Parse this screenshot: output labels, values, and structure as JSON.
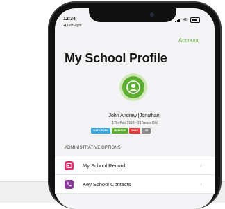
{
  "status": {
    "time": "12:34",
    "back_label": "◀ TestFlight",
    "network": "4G"
  },
  "header": {
    "account_label": "Account",
    "title": "My School Profile"
  },
  "profile": {
    "name": "John Andrew [Jonathan]",
    "dob_age": "17th Feb 1998 - 21 Years Old",
    "tags": [
      {
        "label": "SIXTH FORM",
        "color": "#35a7df"
      },
      {
        "label": "MONITOR",
        "color": "#5fae34"
      },
      {
        "label": "SNAP",
        "color": "#e23a3a"
      },
      {
        "label": "U12",
        "color": "#8a8a8a"
      }
    ]
  },
  "admin": {
    "section_title": "ADMINISTRATIVE OPTIONS",
    "items": [
      {
        "label": "My School Record",
        "icon": "record-icon",
        "color": "#e0316e"
      },
      {
        "label": "Key School Contacts",
        "icon": "phone-icon",
        "color": "#8a3b9c"
      }
    ]
  },
  "colors": {
    "accent": "#6ab23f",
    "avatar": "#5fae34"
  }
}
